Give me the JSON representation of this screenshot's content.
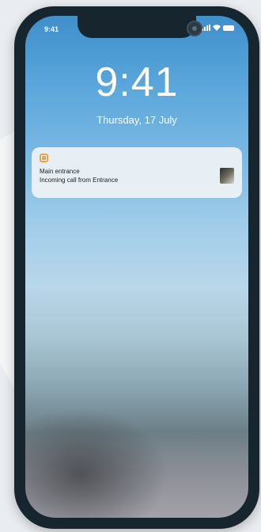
{
  "status_bar": {
    "time": "9:41"
  },
  "lock_screen": {
    "time": "9:41",
    "date": "Thursday, 17 July"
  },
  "notification": {
    "app_icon": "door-icon",
    "title": "Main entrance",
    "body": "Incoming call from Entrance"
  },
  "colors": {
    "phone_frame": "#17262e",
    "app_icon": "#f0a23c"
  }
}
